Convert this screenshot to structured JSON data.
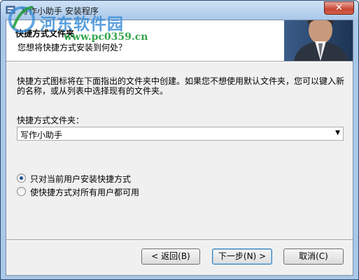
{
  "window": {
    "title": "写作小助手 安装程序",
    "close_glyph": "✕"
  },
  "watermark": {
    "title": "河东软件园",
    "url": "www.pc0359.cn"
  },
  "header": {
    "title": "快捷方式文件夹",
    "subtitle": "您想将快捷方式安装到何处？"
  },
  "body": {
    "description": "快捷方式图标将在下面指出的文件夹中创建。如果您不想使用默认文件夹，您可以键入新的名称，或从列表中选择现有的文件夹。",
    "folder_label": "快捷方式文件夹：",
    "folder_value": "写作小助手",
    "radio_options": [
      {
        "label": "只对当前用户安装快捷方式",
        "checked": true
      },
      {
        "label": "使快捷方式对所有用户都可用",
        "checked": false
      }
    ]
  },
  "buttons": {
    "back": "< 返回(B)",
    "next": "下一步(N) >",
    "cancel": "取消(C)"
  },
  "icons": {
    "app": "installer-icon",
    "combo_arrow": "▼",
    "combo_arrow_name": "chevron-down-icon"
  }
}
